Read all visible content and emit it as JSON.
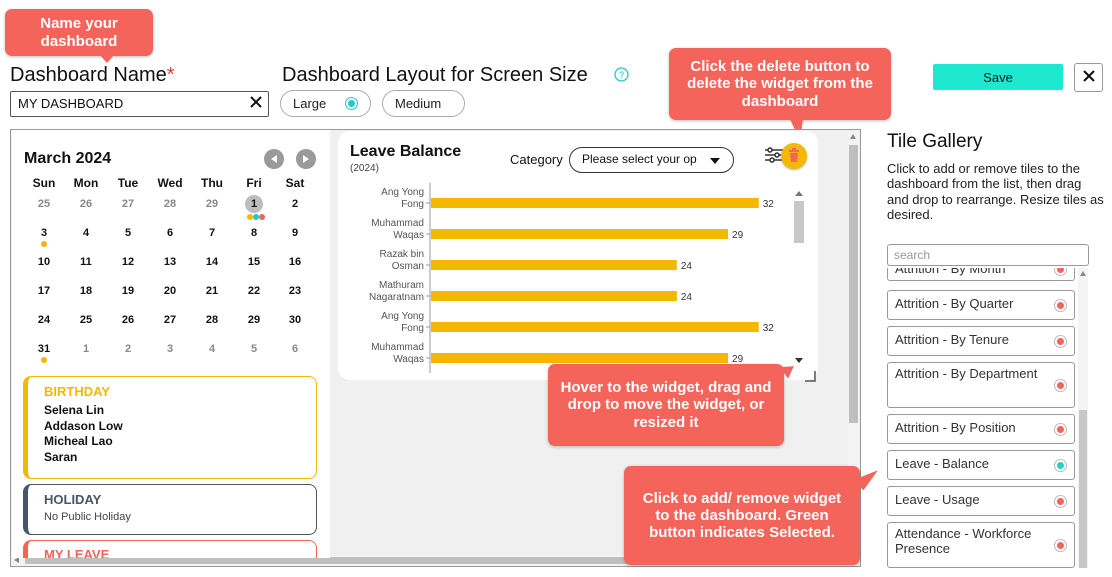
{
  "callouts": {
    "name_dashboard": "Name your dashboard",
    "delete_widget": "Click the delete button to delete the widget from the dashboard",
    "drag_widget": "Hover to the widget, drag and drop to move the widget, or resized it",
    "add_remove": "Click to add/ remove widget to the dashboard. Green button indicates Selected."
  },
  "form": {
    "name_label": "Dashboard Name",
    "required_mark": "*",
    "name_value": "MY DASHBOARD",
    "layout_label": "Dashboard Layout for Screen Size",
    "layout_options": [
      "Large",
      "Medium"
    ],
    "layout_selected": "Large",
    "save_label": "Save"
  },
  "calendar": {
    "month": "March 2024",
    "weekdays": [
      "Sun",
      "Mon",
      "Tue",
      "Wed",
      "Thu",
      "Fri",
      "Sat"
    ],
    "weeks": [
      [
        "25",
        "26",
        "27",
        "28",
        "29",
        "1",
        "2"
      ],
      [
        "3",
        "4",
        "5",
        "6",
        "7",
        "8",
        "9"
      ],
      [
        "10",
        "11",
        "12",
        "13",
        "14",
        "15",
        "16"
      ],
      [
        "17",
        "18",
        "19",
        "20",
        "21",
        "22",
        "23"
      ],
      [
        "24",
        "25",
        "26",
        "27",
        "28",
        "29",
        "30"
      ],
      [
        "31",
        "1",
        "2",
        "3",
        "4",
        "5",
        "6"
      ]
    ],
    "colors": {
      "birthday": "#f5b800",
      "holiday": "#4a5568",
      "leave": "#f4645a",
      "teal": "#22c7c7"
    }
  },
  "events": {
    "birthday_title": "BIRTHDAY",
    "birthday_names": [
      "Selena Lin",
      "Addason Low",
      "Micheal Lao",
      "Saran"
    ],
    "holiday_title": "HOLIDAY",
    "holiday_text": "No Public Holiday",
    "leave_title": "MY LEAVE"
  },
  "widget": {
    "title": "Leave Balance",
    "subtitle": "(2024)",
    "category_label": "Category",
    "category_placeholder": "Please select your op"
  },
  "chart_data": {
    "type": "bar",
    "orientation": "horizontal",
    "categories": [
      "Ang Yong Fong",
      "Muhammad Waqas",
      "Razak bin Osman",
      "Mathuram Nagaratnam",
      "Ang Yong Fong",
      "Muhammad Waqas"
    ],
    "category_lines": [
      [
        "Ang Yong",
        "Fong"
      ],
      [
        "Muhammad",
        "Waqas"
      ],
      [
        "Razak bin",
        "Osman"
      ],
      [
        "Mathuram",
        "Nagaratnam"
      ],
      [
        "Ang Yong",
        "Fong"
      ],
      [
        "Muhammad",
        "Waqas"
      ]
    ],
    "values": [
      32,
      29,
      24,
      24,
      32,
      29
    ],
    "xlim": [
      0,
      33
    ],
    "bar_color": "#f5b800",
    "grid": false
  },
  "gallery": {
    "title": "Tile Gallery",
    "description": "Click to add or remove tiles to the dashboard from the list, then drag and drop to rearrange. Resize tiles as desired.",
    "search_placeholder": "search",
    "partial_tile": "Attrition - By Month",
    "tiles": [
      {
        "label": "Attrition - By Quarter",
        "selected": false
      },
      {
        "label": "Attrition - By Tenure",
        "selected": false
      },
      {
        "label": "Attrition - By Department",
        "selected": false
      },
      {
        "label": "Attrition - By Position",
        "selected": false
      },
      {
        "label": "Leave - Balance",
        "selected": true
      },
      {
        "label": "Leave - Usage",
        "selected": false
      },
      {
        "label": "Attendance - Workforce Presence",
        "selected": false
      }
    ],
    "selected_color": "#22d3c5",
    "unselected_color": "#f4645a"
  },
  "icons": {
    "close": "close-icon",
    "clear": "clear-icon",
    "help": "help-icon",
    "prev": "chevron-left-icon",
    "next": "chevron-right-icon",
    "settings": "sliders-icon",
    "delete": "trash-icon",
    "resize": "resize-handle-icon"
  }
}
